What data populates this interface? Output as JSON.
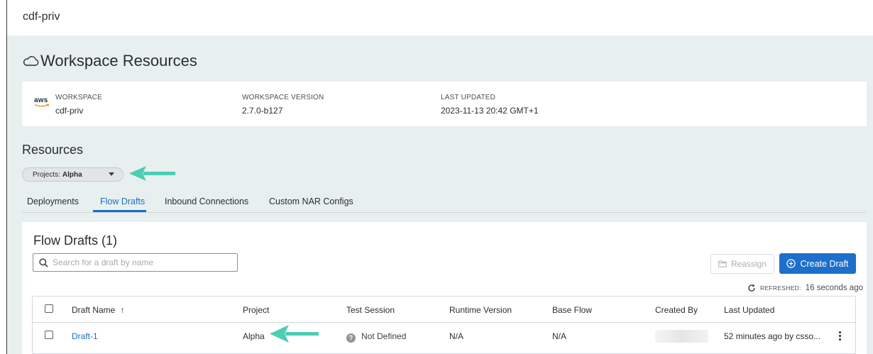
{
  "top": {
    "title": "cdf-priv"
  },
  "workspace_resources": {
    "title": "Workspace Resources",
    "cloud_provider": "aws",
    "fields": [
      {
        "label": "WORKSPACE",
        "value": "cdf-priv"
      },
      {
        "label": "WORKSPACE VERSION",
        "value": "2.7.0-b127"
      },
      {
        "label": "LAST UPDATED",
        "value": "2023-11-13 20:42 GMT+1"
      }
    ]
  },
  "resources": {
    "title": "Resources",
    "project_filter": {
      "label": "Projects:",
      "value": "Alpha"
    },
    "tabs": [
      {
        "label": "Deployments",
        "active": false
      },
      {
        "label": "Flow Drafts",
        "active": true
      },
      {
        "label": "Inbound Connections",
        "active": false
      },
      {
        "label": "Custom NAR Configs",
        "active": false
      }
    ]
  },
  "flow_drafts": {
    "title": "Flow Drafts (1)",
    "search_placeholder": "Search for a draft by name",
    "reassign_label": "Reassign",
    "create_label": "Create Draft",
    "refreshed_label": "REFRESHED:",
    "refreshed_value": "16 seconds ago",
    "columns": [
      "Draft Name",
      "Project",
      "Test Session",
      "Runtime Version",
      "Base Flow",
      "Created By",
      "Last Updated"
    ],
    "sort_indicator": "↑",
    "rows": [
      {
        "draft_name": "Draft-1",
        "project": "Alpha",
        "test_session": "Not Defined",
        "runtime_version": "N/A",
        "base_flow": "N/A",
        "created_by": "",
        "last_updated": "52 minutes ago by csso..."
      }
    ]
  },
  "colors": {
    "accent": "#1c6fcb",
    "annotation_arrow": "#4ecdb4",
    "background": "#e8f0ef"
  }
}
